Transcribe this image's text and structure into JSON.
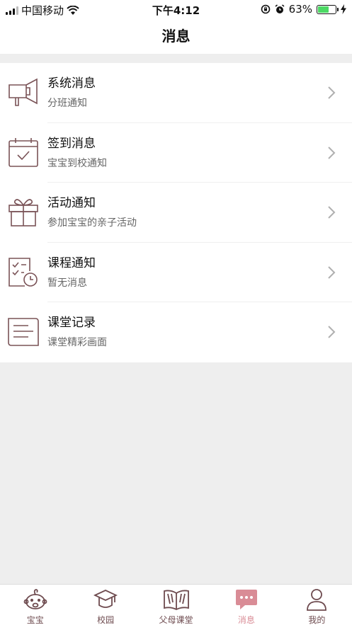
{
  "status_bar": {
    "carrier": "中国移动",
    "time": "下午4:12",
    "battery_percent": "63%",
    "battery_level": 0.63
  },
  "nav": {
    "title": "消息"
  },
  "messages": [
    {
      "title": "系统消息",
      "subtitle": "分班通知",
      "icon": "megaphone-icon"
    },
    {
      "title": "签到消息",
      "subtitle": "宝宝到校通知",
      "icon": "calendar-check-icon"
    },
    {
      "title": "活动通知",
      "subtitle": "参加宝宝的亲子活动",
      "icon": "gift-icon"
    },
    {
      "title": "课程通知",
      "subtitle": "暂无消息",
      "icon": "checklist-clock-icon"
    },
    {
      "title": "课堂记录",
      "subtitle": "课堂精彩画面",
      "icon": "notebook-icon"
    }
  ],
  "tabs": [
    {
      "label": "宝宝",
      "icon": "baby-face-icon",
      "active": false
    },
    {
      "label": "校园",
      "icon": "graduation-cap-icon",
      "active": false
    },
    {
      "label": "父母课堂",
      "icon": "open-book-icon",
      "active": false
    },
    {
      "label": "消息",
      "icon": "chat-bubble-icon",
      "active": true
    },
    {
      "label": "我的",
      "icon": "person-icon",
      "active": false
    }
  ],
  "colors": {
    "icon_stroke": "#7a5357",
    "active_tab": "#d98c96",
    "chevron": "#b0b0b0"
  }
}
